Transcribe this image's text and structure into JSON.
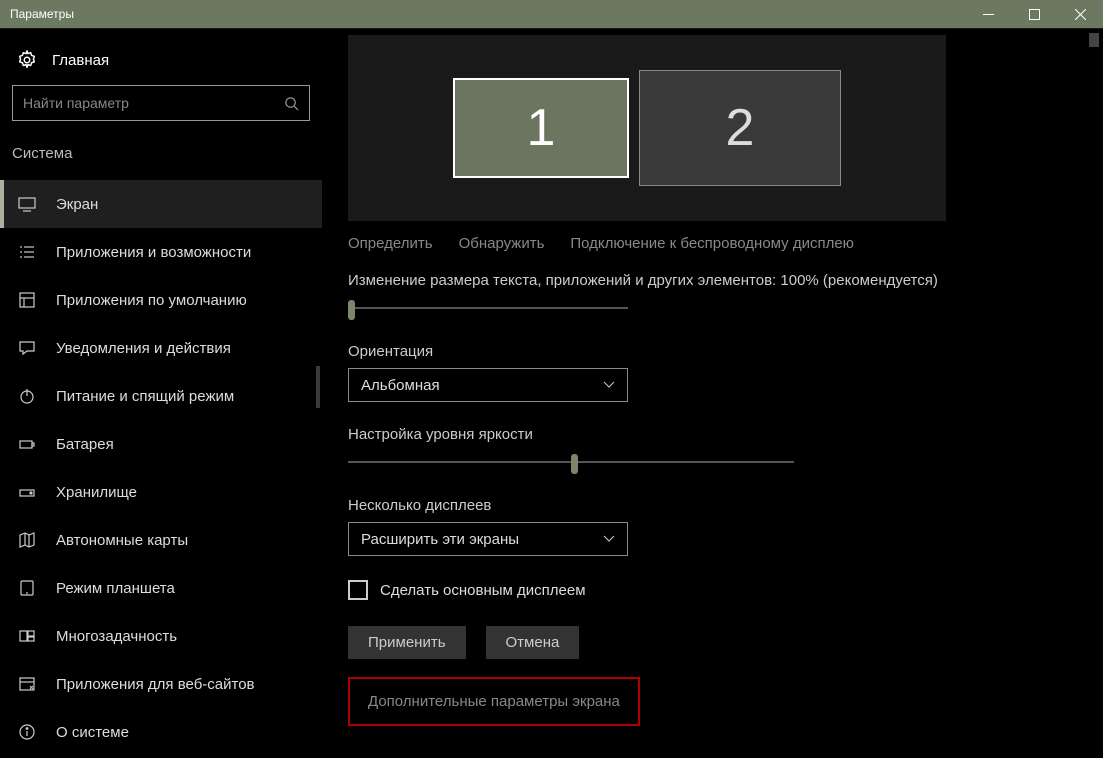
{
  "titlebar": {
    "title": "Параметры"
  },
  "sidebar": {
    "home": "Главная",
    "search_placeholder": "Найти параметр",
    "category": "Система",
    "items": [
      {
        "label": "Экран"
      },
      {
        "label": "Приложения и возможности"
      },
      {
        "label": "Приложения по умолчанию"
      },
      {
        "label": "Уведомления и действия"
      },
      {
        "label": "Питание и спящий режим"
      },
      {
        "label": "Батарея"
      },
      {
        "label": "Хранилище"
      },
      {
        "label": "Автономные карты"
      },
      {
        "label": "Режим планшета"
      },
      {
        "label": "Многозадачность"
      },
      {
        "label": "Приложения для веб-сайтов"
      },
      {
        "label": "О системе"
      }
    ]
  },
  "content": {
    "monitor1": "1",
    "monitor2": "2",
    "links": {
      "identify": "Определить",
      "detect": "Обнаружить",
      "wireless": "Подключение к беспроводному дисплею"
    },
    "scale_label": "Изменение размера текста, приложений и других элементов: 100% (рекомендуется)",
    "orientation_label": "Ориентация",
    "orientation_value": "Альбомная",
    "brightness_label": "Настройка уровня яркости",
    "multi_label": "Несколько дисплеев",
    "multi_value": "Расширить эти экраны",
    "primary_checkbox": "Сделать основным дисплеем",
    "apply": "Применить",
    "cancel": "Отмена",
    "advanced": "Дополнительные параметры экрана"
  }
}
